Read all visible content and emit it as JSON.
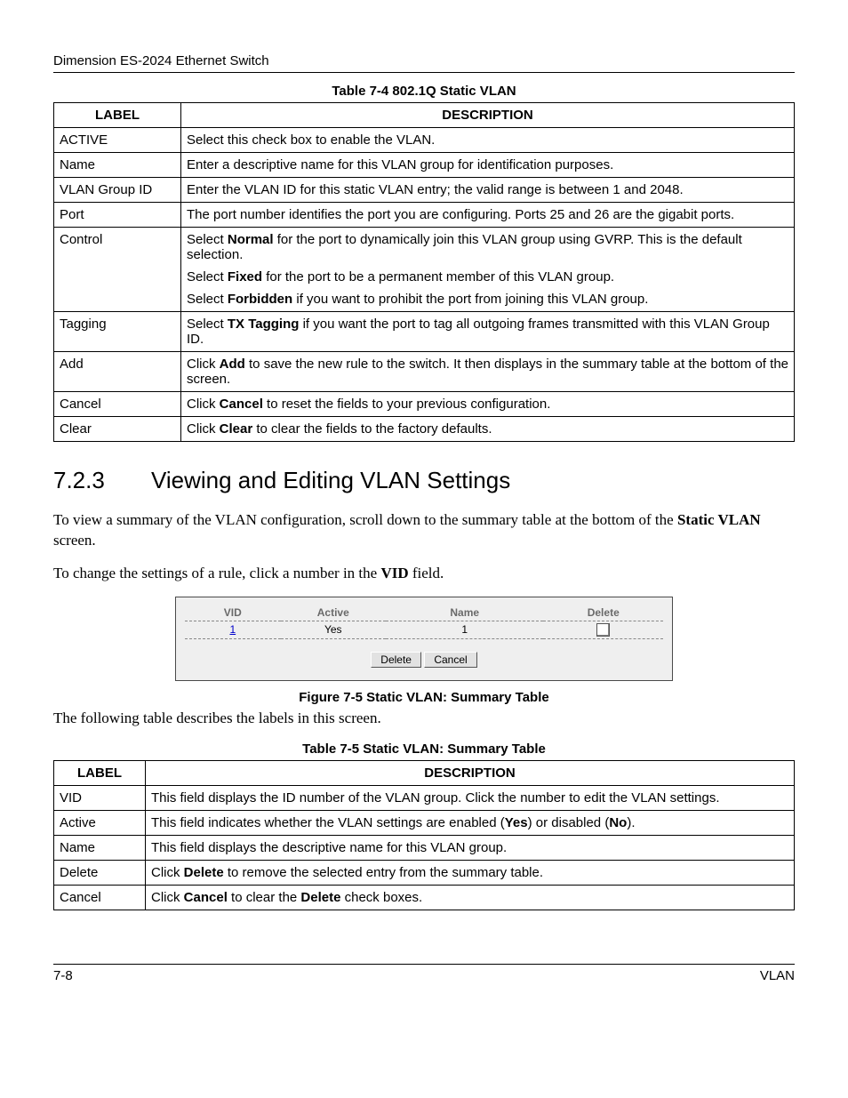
{
  "header": "Dimension ES-2024 Ethernet Switch",
  "table74": {
    "caption": "Table 7-4 802.1Q Static VLAN",
    "head": {
      "label": "LABEL",
      "desc": "DESCRIPTION"
    },
    "rows": [
      {
        "label": "ACTIVE",
        "desc": [
          {
            "pre": "",
            "bold": "",
            "post": "Select this check box to enable the VLAN."
          }
        ]
      },
      {
        "label": "Name",
        "desc": [
          {
            "pre": "",
            "bold": "",
            "post": "Enter a descriptive name for this VLAN group for identification purposes."
          }
        ]
      },
      {
        "label": "VLAN Group ID",
        "desc": [
          {
            "pre": "",
            "bold": "",
            "post": "Enter the VLAN ID for this static VLAN entry; the valid range is between 1 and 2048."
          }
        ]
      },
      {
        "label": "Port",
        "desc": [
          {
            "pre": "",
            "bold": "",
            "post": "The port number identifies the port you are configuring. Ports 25 and 26 are the gigabit ports."
          }
        ]
      },
      {
        "label": "Control",
        "desc": [
          {
            "pre": "Select ",
            "bold": "Normal",
            "post": " for the port to dynamically join this VLAN group using GVRP. This is the default selection."
          },
          {
            "pre": "Select ",
            "bold": "Fixed",
            "post": " for the port to be a permanent member of this VLAN group."
          },
          {
            "pre": "Select ",
            "bold": "Forbidden",
            "post": " if you want to prohibit the port from joining this VLAN group."
          }
        ]
      },
      {
        "label": "Tagging",
        "desc": [
          {
            "pre": "Select ",
            "bold": "TX Tagging",
            "post": " if you want the port to tag all outgoing frames transmitted with this VLAN Group ID."
          }
        ]
      },
      {
        "label": "Add",
        "desc": [
          {
            "pre": "Click ",
            "bold": "Add",
            "post": " to save the new rule to the switch. It then displays in the summary table at the bottom of the screen."
          }
        ]
      },
      {
        "label": "Cancel",
        "desc": [
          {
            "pre": "Click ",
            "bold": "Cancel",
            "post": " to reset the fields to your previous configuration."
          }
        ]
      },
      {
        "label": "Clear",
        "desc": [
          {
            "pre": "Click ",
            "bold": "Clear",
            "post": " to clear the fields to the factory defaults."
          }
        ]
      }
    ]
  },
  "section": {
    "num": "7.2.3",
    "title": "Viewing and Editing VLAN Settings"
  },
  "para1": {
    "pre": "To view a summary of the VLAN configuration, scroll down to the summary table at the bottom of the ",
    "bold": "Static VLAN",
    "post": " screen."
  },
  "para2": {
    "pre": "To change the settings of a rule, click a number in the ",
    "bold": "VID",
    "post": " field."
  },
  "figure": {
    "head": {
      "vid": "VID",
      "active": "Active",
      "name": "Name",
      "delete": "Delete"
    },
    "row": {
      "vid": "1",
      "active": "Yes",
      "name": "1"
    },
    "buttons": {
      "delete": "Delete",
      "cancel": "Cancel"
    },
    "caption": "Figure 7-5 Static VLAN: Summary Table"
  },
  "para3": "The following table describes the labels in this screen.",
  "table75": {
    "caption": "Table 7-5 Static VLAN: Summary Table",
    "head": {
      "label": "LABEL",
      "desc": "DESCRIPTION"
    },
    "rows": [
      {
        "label": "VID",
        "desc": [
          {
            "pre": "",
            "bold": "",
            "post": "This field displays the ID number of the VLAN group. Click the number to edit the VLAN settings."
          }
        ]
      },
      {
        "label": "Active",
        "desc": [
          {
            "pre": "This field indicates whether the VLAN settings are enabled (",
            "bold": "Yes",
            "post": ") or disabled (",
            "bold2": "No",
            "post2": ")."
          }
        ]
      },
      {
        "label": "Name",
        "desc": [
          {
            "pre": "",
            "bold": "",
            "post": "This field displays the descriptive name for this VLAN group."
          }
        ]
      },
      {
        "label": "Delete",
        "desc": [
          {
            "pre": "Click ",
            "bold": "Delete",
            "post": " to remove the selected entry from the summary table."
          }
        ]
      },
      {
        "label": "Cancel",
        "desc": [
          {
            "pre": "Click ",
            "bold": "Cancel",
            "post": " to clear the ",
            "bold2": "Delete",
            "post2": " check boxes."
          }
        ]
      }
    ]
  },
  "footer": {
    "page": "7-8",
    "section": "VLAN"
  }
}
